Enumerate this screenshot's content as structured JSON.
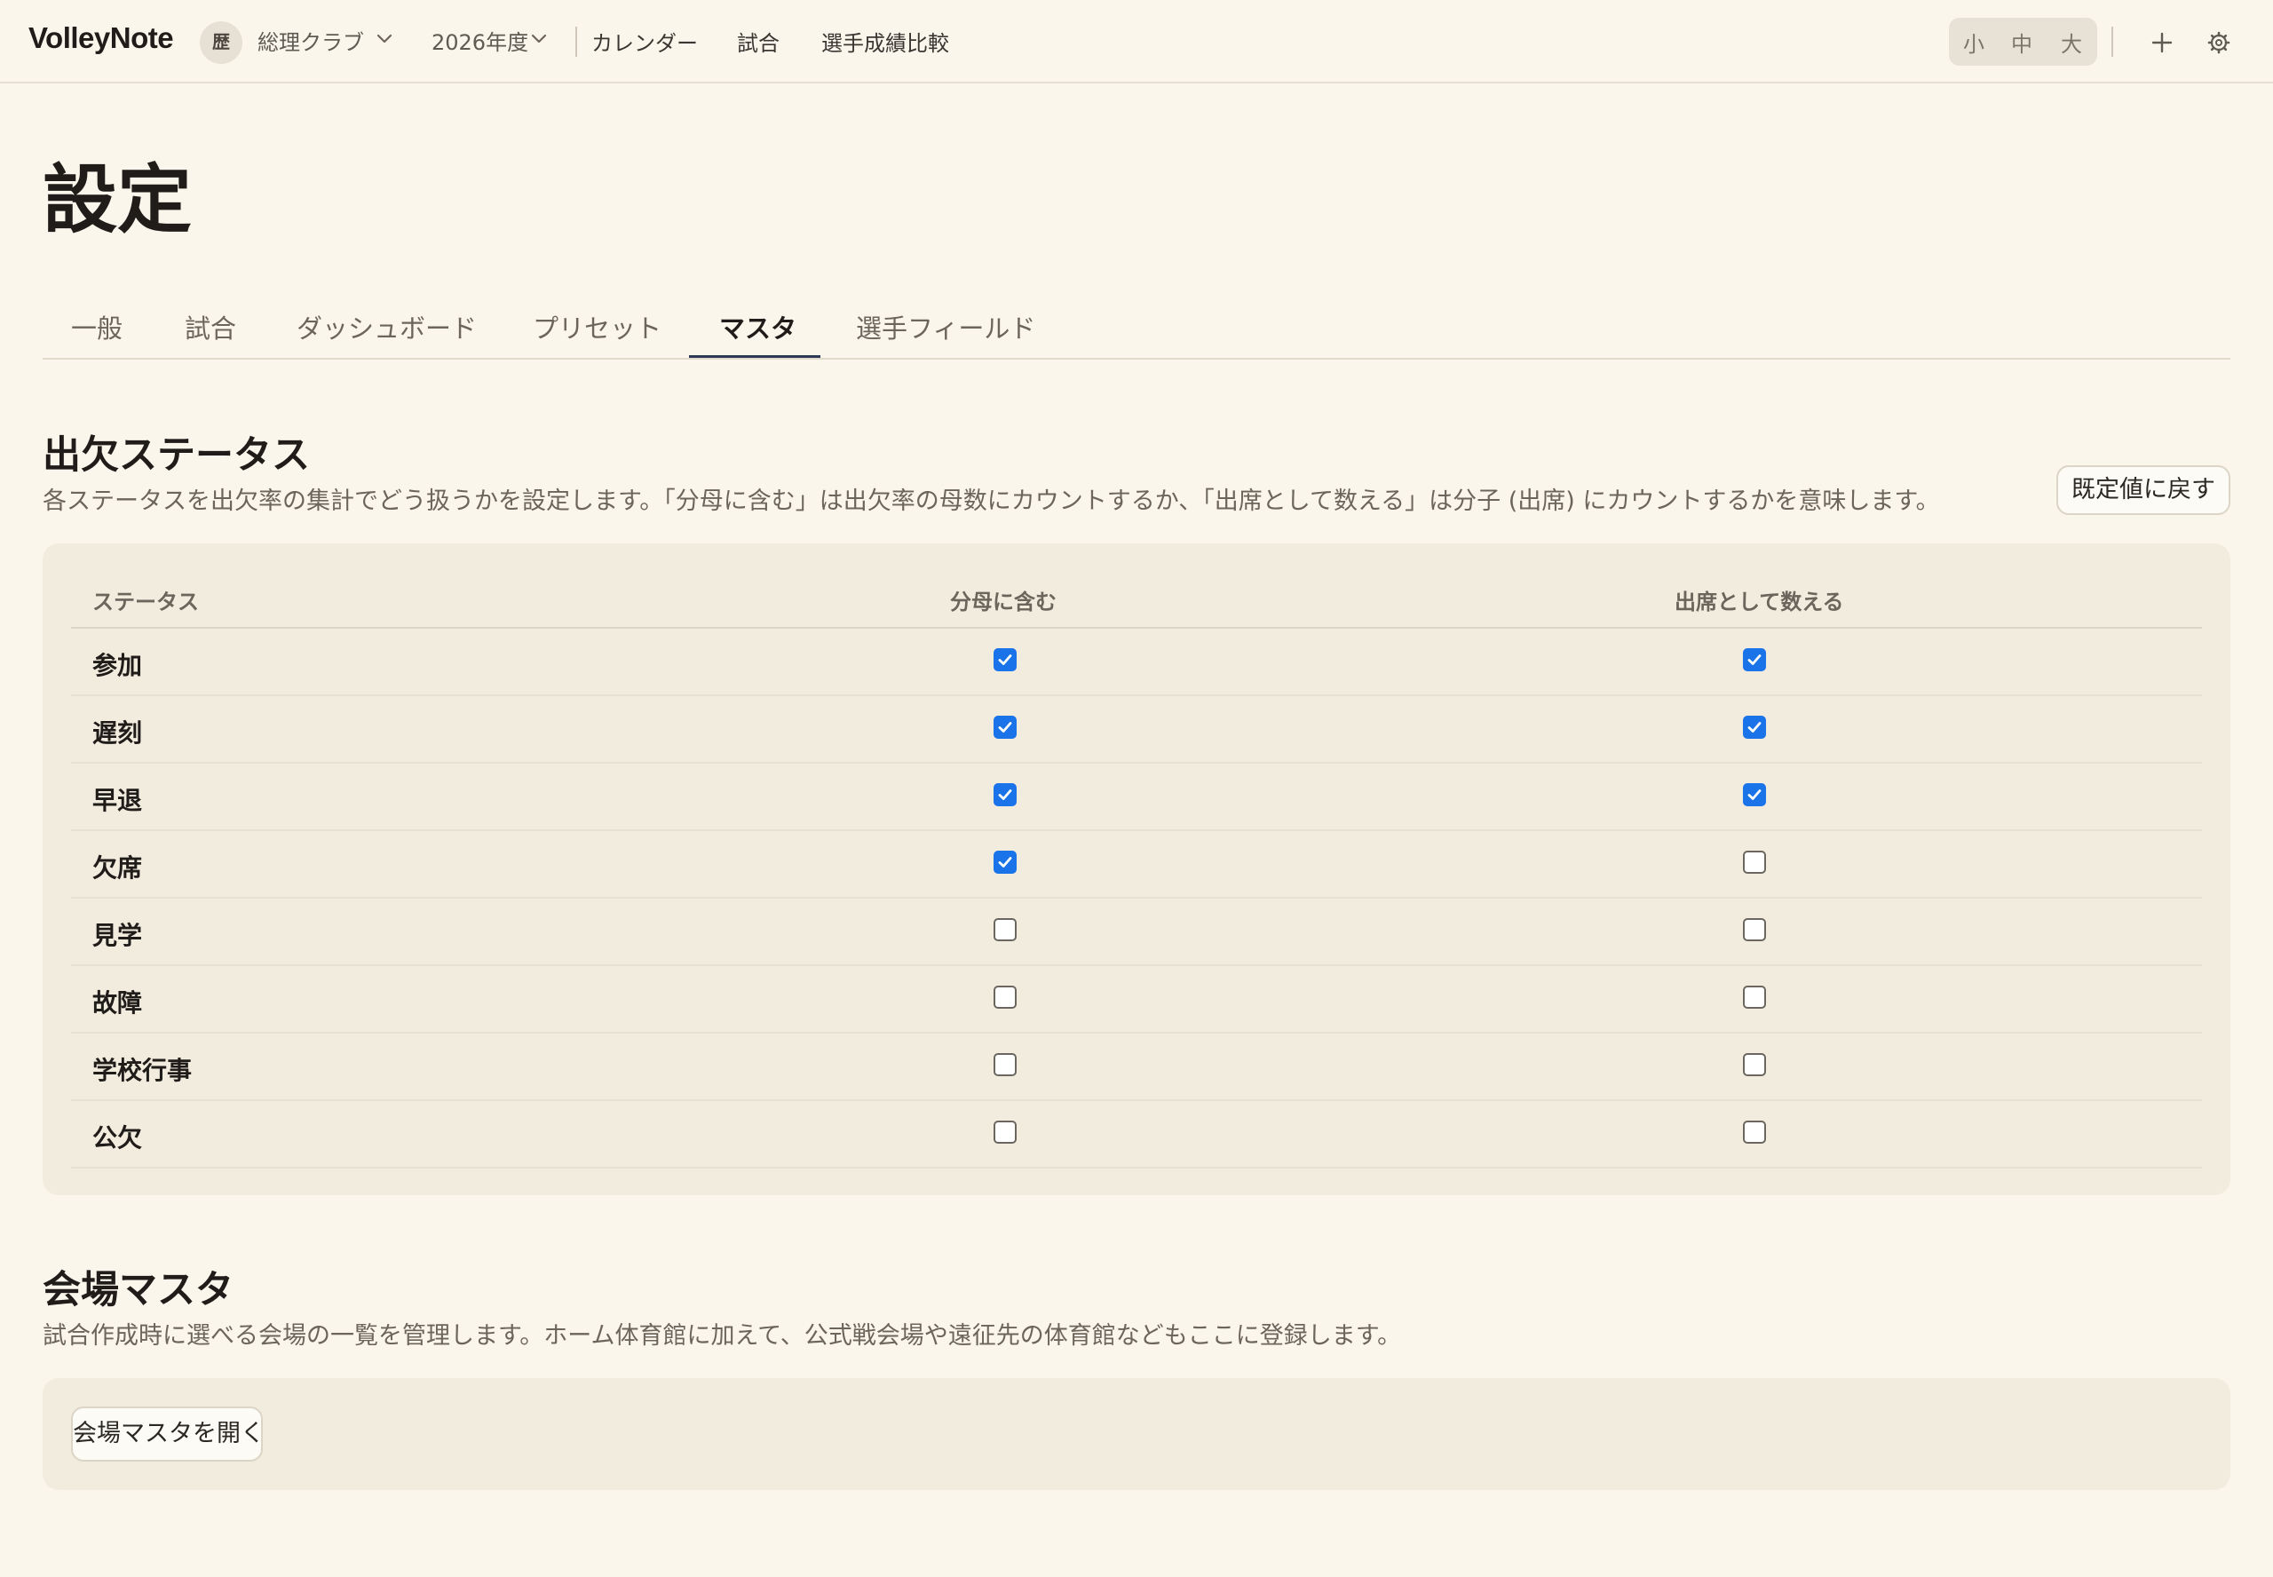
{
  "app": {
    "brand": "VolleyNote",
    "club_avatar": "歴",
    "club_name": "総理クラブ",
    "season": "2026年度",
    "nav": [
      "カレンダー",
      "試合",
      "選手成績比較"
    ],
    "font_sizes": [
      "小",
      "中",
      "大"
    ],
    "icons": [
      "chevron-down-icon",
      "plus-icon",
      "gear-icon",
      "check-icon"
    ]
  },
  "page": {
    "title": "設定",
    "tabs": [
      {
        "label": "一般",
        "active": false
      },
      {
        "label": "試合",
        "active": false
      },
      {
        "label": "ダッシュボード",
        "active": false
      },
      {
        "label": "プリセット",
        "active": false
      },
      {
        "label": "マスタ",
        "active": true
      },
      {
        "label": "選手フィールド",
        "active": false
      }
    ]
  },
  "attendance": {
    "title": "出欠ステータス",
    "description": "各ステータスを出欠率の集計でどう扱うかを設定します。「分母に含む」は出欠率の母数にカウントするか、「出席として数える」は分子 (出席) にカウントするかを意味します。",
    "reset_button": "既定値に戻す",
    "columns": [
      "ステータス",
      "分母に含む",
      "出席として数える"
    ],
    "rows": [
      {
        "label": "参加",
        "denominator": true,
        "present": true
      },
      {
        "label": "遅刻",
        "denominator": true,
        "present": true
      },
      {
        "label": "早退",
        "denominator": true,
        "present": true
      },
      {
        "label": "欠席",
        "denominator": true,
        "present": false
      },
      {
        "label": "見学",
        "denominator": false,
        "present": false
      },
      {
        "label": "故障",
        "denominator": false,
        "present": false
      },
      {
        "label": "学校行事",
        "denominator": false,
        "present": false
      },
      {
        "label": "公欠",
        "denominator": false,
        "present": false
      }
    ]
  },
  "venue": {
    "title": "会場マスタ",
    "description": "試合作成時に選べる会場の一覧を管理します。ホーム体育館に加えて、公式戦会場や遠征先の体育館などもここに登録します。",
    "button": "会場マスタを開く"
  },
  "colors": {
    "background": "#faf6ec",
    "card": "#f2ecdf",
    "accent": "#1a73e8",
    "tab_underline": "#2e3a55"
  }
}
